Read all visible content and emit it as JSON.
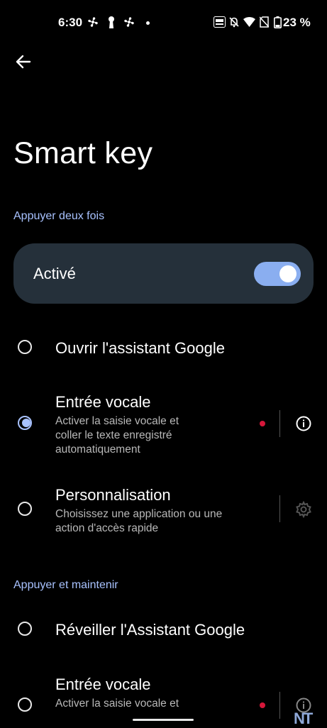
{
  "status_bar": {
    "time": "6:30",
    "battery": "23 %"
  },
  "header": {
    "title": "Smart key"
  },
  "sections": {
    "double_tap": "Appuyer deux fois",
    "hold": "Appuyer et maintenir"
  },
  "toggle": {
    "label": "Activé",
    "on": true
  },
  "double_tap_options": [
    {
      "title": "Ouvrir l'assistant Google",
      "selected": false
    },
    {
      "title": "Entrée vocale",
      "subtitle_1": "Activer la saisie vocale et",
      "subtitle_2": "coller le texte enregistré",
      "subtitle_3": "automatiquement",
      "selected": true
    },
    {
      "title": "Personnalisation",
      "subtitle_1": "Choisissez une application ou une",
      "subtitle_2": "action d'accès rapide",
      "selected": false
    }
  ],
  "hold_options": [
    {
      "title": "Réveiller l'Assistant Google",
      "selected": false
    },
    {
      "title": "Entrée vocale",
      "subtitle_1": "Activer la saisie vocale et",
      "selected": false
    }
  ],
  "watermark": "NT",
  "colors": {
    "accent": "#a8c2ff",
    "card": "#25303a",
    "switch_track": "#8aaef0",
    "record_dot": "#d6173a"
  }
}
